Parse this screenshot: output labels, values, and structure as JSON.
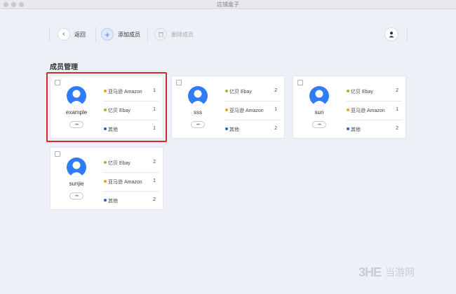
{
  "window": {
    "title": "店铺盒子"
  },
  "toolbar": {
    "back_label": "返回",
    "add_label": "添加成员",
    "delete_label": "删除成员"
  },
  "section_title": "成员管理",
  "members": [
    {
      "name": "example",
      "selected": true,
      "stats": [
        {
          "label": "亚马逊 Amazon",
          "value": "1",
          "color": "#e8a317"
        },
        {
          "label": "亿贝 Ebay",
          "value": "1",
          "color": "#8fbf2a"
        },
        {
          "label": "其他",
          "value": "1",
          "color": "#2d5fd1"
        }
      ]
    },
    {
      "name": "sss",
      "selected": false,
      "stats": [
        {
          "label": "亿贝 Ebay",
          "value": "2",
          "color": "#8fbf2a"
        },
        {
          "label": "亚马逊 Amazon",
          "value": "1",
          "color": "#e8a317"
        },
        {
          "label": "其他",
          "value": "2",
          "color": "#2d5fd1"
        }
      ]
    },
    {
      "name": "sun",
      "selected": false,
      "stats": [
        {
          "label": "亿贝 Ebay",
          "value": "2",
          "color": "#8fbf2a"
        },
        {
          "label": "亚马逊 Amazon",
          "value": "1",
          "color": "#e8a317"
        },
        {
          "label": "其他",
          "value": "2",
          "color": "#2d5fd1"
        }
      ]
    },
    {
      "name": "sunjie",
      "selected": false,
      "stats": [
        {
          "label": "亿贝 Ebay",
          "value": "2",
          "color": "#8fbf2a"
        },
        {
          "label": "亚马逊 Amazon",
          "value": "1",
          "color": "#e8a317"
        },
        {
          "label": "其他",
          "value": "2",
          "color": "#2d5fd1"
        }
      ]
    }
  ],
  "watermark": {
    "logo": "3HE",
    "text": "当游网"
  },
  "colors": {
    "accent": "#2e7cf6",
    "selection": "#d22a2a",
    "background": "#eef0f8"
  }
}
